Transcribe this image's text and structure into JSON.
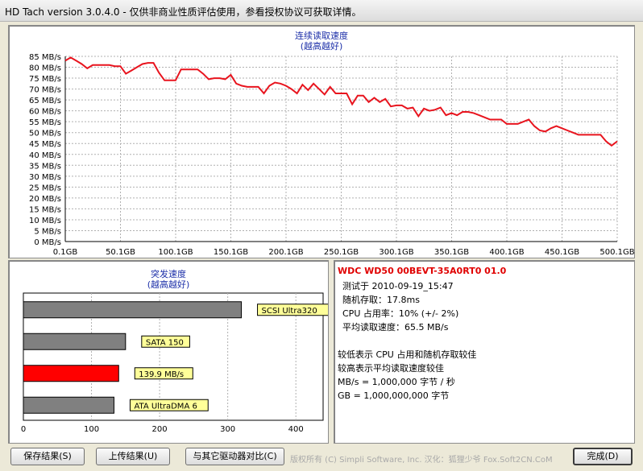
{
  "window": {
    "title": "HD Tach version 3.0.4.0  - 仅供非商业性质评估使用，参看授权协议可获取详情。"
  },
  "chart_data": [
    {
      "type": "line",
      "title": "连续读取速度",
      "subtitle": "(越高越好)",
      "y_tick_labels": [
        "85 MB/s",
        "80 MB/s",
        "75 MB/s",
        "70 MB/s",
        "65 MB/s",
        "60 MB/s",
        "55 MB/s",
        "50 MB/s",
        "45 MB/s",
        "40 MB/s",
        "35 MB/s",
        "30 MB/s",
        "25 MB/s",
        "20 MB/s",
        "15 MB/s",
        "10 MB/s",
        "5 MB/s",
        "0 MB/s"
      ],
      "x_tick_labels": [
        "0.1GB",
        "50.1GB",
        "100.1GB",
        "150.1GB",
        "200.1GB",
        "250.1GB",
        "300.1GB",
        "350.1GB",
        "400.1GB",
        "450.1GB",
        "500.1GB"
      ],
      "xlim": [
        0.1,
        500.1
      ],
      "ylim": [
        0,
        85
      ],
      "grid": true,
      "series": [
        {
          "color": "#e8141e",
          "x": [
            0.1,
            5,
            10,
            15,
            20,
            25,
            30,
            35,
            40,
            45,
            50,
            55,
            60,
            65,
            70,
            75,
            80,
            85,
            90,
            95,
            100,
            105,
            110,
            115,
            120,
            125,
            130,
            135,
            140,
            145,
            150,
            155,
            160,
            165,
            170,
            175,
            180,
            185,
            190,
            195,
            200,
            205,
            210,
            215,
            220,
            225,
            230,
            235,
            240,
            245,
            250,
            255,
            260,
            265,
            270,
            275,
            280,
            285,
            290,
            295,
            300,
            305,
            310,
            315,
            320,
            325,
            330,
            335,
            340,
            345,
            350,
            355,
            360,
            365,
            370,
            375,
            380,
            385,
            390,
            395,
            400,
            405,
            410,
            415,
            420,
            425,
            430,
            435,
            440,
            445,
            450,
            455,
            460,
            465,
            470,
            475,
            480,
            485,
            490,
            495,
            500.1
          ],
          "y": [
            83,
            84.5,
            83,
            81.5,
            79.5,
            81,
            81,
            81,
            81,
            80.5,
            80.5,
            77,
            78.5,
            80,
            81.5,
            82,
            82,
            77.5,
            74,
            74,
            74,
            79,
            79,
            79,
            79,
            77,
            74.5,
            75,
            75,
            74.5,
            76.5,
            72.5,
            71.5,
            71,
            71,
            71,
            68,
            71.5,
            73,
            72.5,
            71.5,
            70,
            68,
            72,
            69.5,
            72.5,
            70,
            67.5,
            71,
            68,
            68,
            68,
            63,
            67,
            67,
            64,
            66,
            64,
            65.5,
            62,
            62.5,
            62.5,
            61,
            61.5,
            57.5,
            61,
            60,
            60.5,
            61.5,
            58,
            59,
            58,
            59.5,
            59.5,
            59,
            58,
            57,
            56,
            56,
            56,
            54,
            54,
            54,
            55,
            56,
            53,
            51,
            50.5,
            52,
            53,
            52,
            51,
            50,
            49,
            49,
            49,
            49,
            49,
            46,
            44,
            46
          ]
        }
      ]
    },
    {
      "type": "bar",
      "title": "突发速度",
      "subtitle": "(越高越好)",
      "orientation": "horizontal",
      "x_tick_labels": [
        "0",
        "100",
        "200",
        "300",
        "400"
      ],
      "xlim": [
        0,
        440
      ],
      "grid": true,
      "categories": [
        "SCSI Ultra320",
        "SATA 150",
        "139.9 MB/s",
        "ATA UltraDMA 6"
      ],
      "values": [
        320,
        150,
        139.9,
        133
      ],
      "colors": [
        "#808080",
        "#808080",
        "#ff0000",
        "#808080"
      ]
    }
  ],
  "info": {
    "drive_model": "WDC WD50 00BEVT-35A0RT0 01.0",
    "test_time": "测试于 2010-09-19_15:47",
    "random_access": "随机存取：17.8ms",
    "cpu_usage": "CPU 占用率：10% (+/- 2%)",
    "avg_read": "平均读取速度：65.5 MB/s",
    "note_lower": "较低表示 CPU 占用和随机存取较佳",
    "note_higher": "较高表示平均读取速度较佳",
    "unit_mb": "MB/s = 1,000,000 字节 / 秒",
    "unit_gb": "GB = 1,000,000,000 字节"
  },
  "buttons": {
    "save": "保存结果(S)",
    "upload": "上传结果(U)",
    "compare": "与其它驱动器对比(C)",
    "done": "完成(D)"
  },
  "credit": "版权所有 (C) Simpli Software, Inc. 汉化：狐狸少爷 Fox.Soft2CN.CoM"
}
